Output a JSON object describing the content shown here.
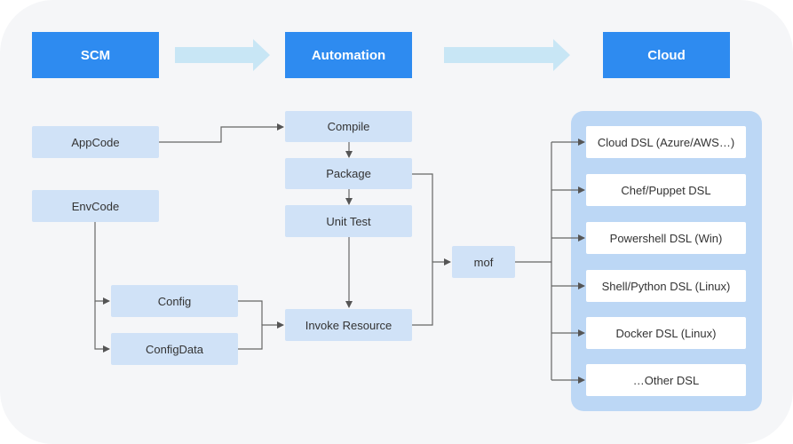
{
  "stages": {
    "scm": "SCM",
    "automation": "Automation",
    "cloud": "Cloud"
  },
  "colors": {
    "header": "#2e8bf0",
    "node": "#d0e2f7",
    "stage_arrow": "#c8e6f5",
    "dsl_panel": "#bcd7f5",
    "connector": "#555555"
  },
  "nodes": {
    "appcode": "AppCode",
    "envcode": "EnvCode",
    "config": "Config",
    "configdata": "ConfigData",
    "compile": "Compile",
    "package": "Package",
    "unit_test": "Unit Test",
    "invoke_resource": "Invoke Resource",
    "mof": "mof"
  },
  "dsl_targets": [
    "Cloud DSL (Azure/AWS…)",
    "Chef/Puppet DSL",
    "Powershell DSL (Win)",
    "Shell/Python DSL (Linux)",
    "Docker DSL (Linux)",
    "…Other DSL"
  ]
}
